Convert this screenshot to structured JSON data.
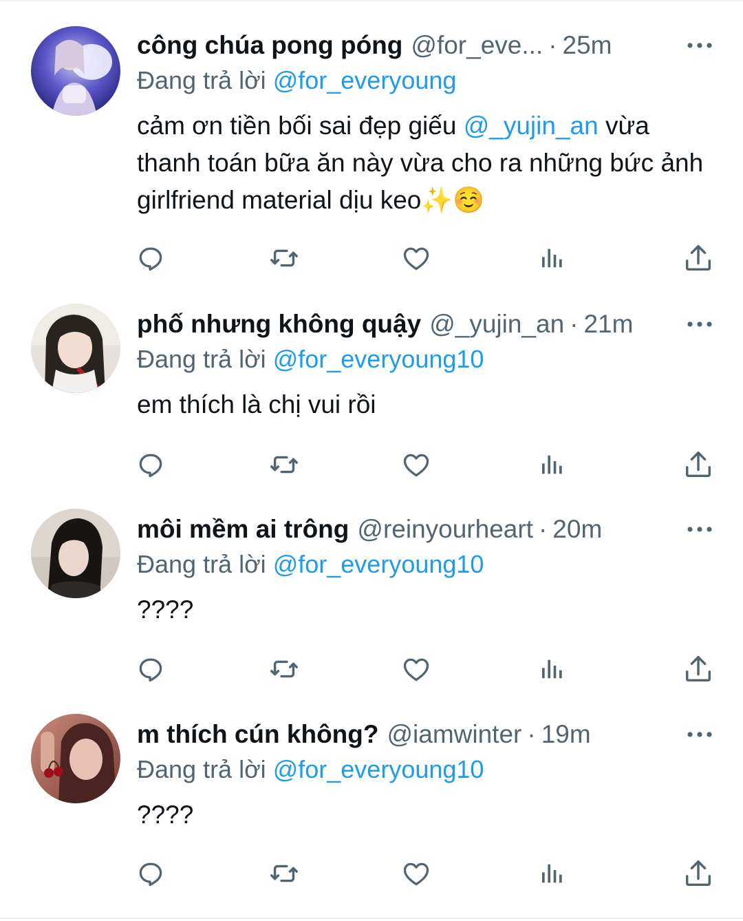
{
  "colors": {
    "text_primary": "#0f1419",
    "text_secondary": "#536471",
    "mention": "#1d9bf0",
    "icon": "#536471"
  },
  "replies": [
    {
      "display_name": "công chúa pong póng",
      "handle": "@for_eve...",
      "separator": "·",
      "time": "25m",
      "replying_prefix": "Đang trả lời",
      "replying_to": "@for_everyoung",
      "text_before_mention": "cảm ơn tiền bối sai đẹp giếu ",
      "mention": "@_yujin_an",
      "text_after_mention": " vừa thanh toán bữa ăn này vừa cho ra những bức ảnh girlfriend material dịu keo✨☺️",
      "actions": [
        "reply-icon",
        "retweet-icon",
        "like-icon",
        "views-icon",
        "share-icon"
      ]
    },
    {
      "display_name": "phố nhưng không quậy",
      "handle": "@_yujin_an",
      "separator": "·",
      "time": "21m",
      "replying_prefix": "Đang trả lời",
      "replying_to": "@for_everyoung10",
      "text": "em thích là chị vui rồi",
      "actions": [
        "reply-icon",
        "retweet-icon",
        "like-icon",
        "views-icon",
        "share-icon"
      ]
    },
    {
      "display_name": "môi mềm ai trông",
      "handle": "@reinyourheart",
      "separator": "·",
      "time": "20m",
      "replying_prefix": "Đang trả lời",
      "replying_to": "@for_everyoung10",
      "text": "????",
      "actions": [
        "reply-icon",
        "retweet-icon",
        "like-icon",
        "views-icon",
        "share-icon"
      ]
    },
    {
      "display_name": "m thích cún không?",
      "handle": "@iamwinter",
      "separator": "·",
      "time": "19m",
      "replying_prefix": "Đang trả lời",
      "replying_to": "@for_everyoung10",
      "text": "????",
      "actions": [
        "reply-icon",
        "retweet-icon",
        "like-icon",
        "views-icon",
        "share-icon"
      ]
    }
  ]
}
